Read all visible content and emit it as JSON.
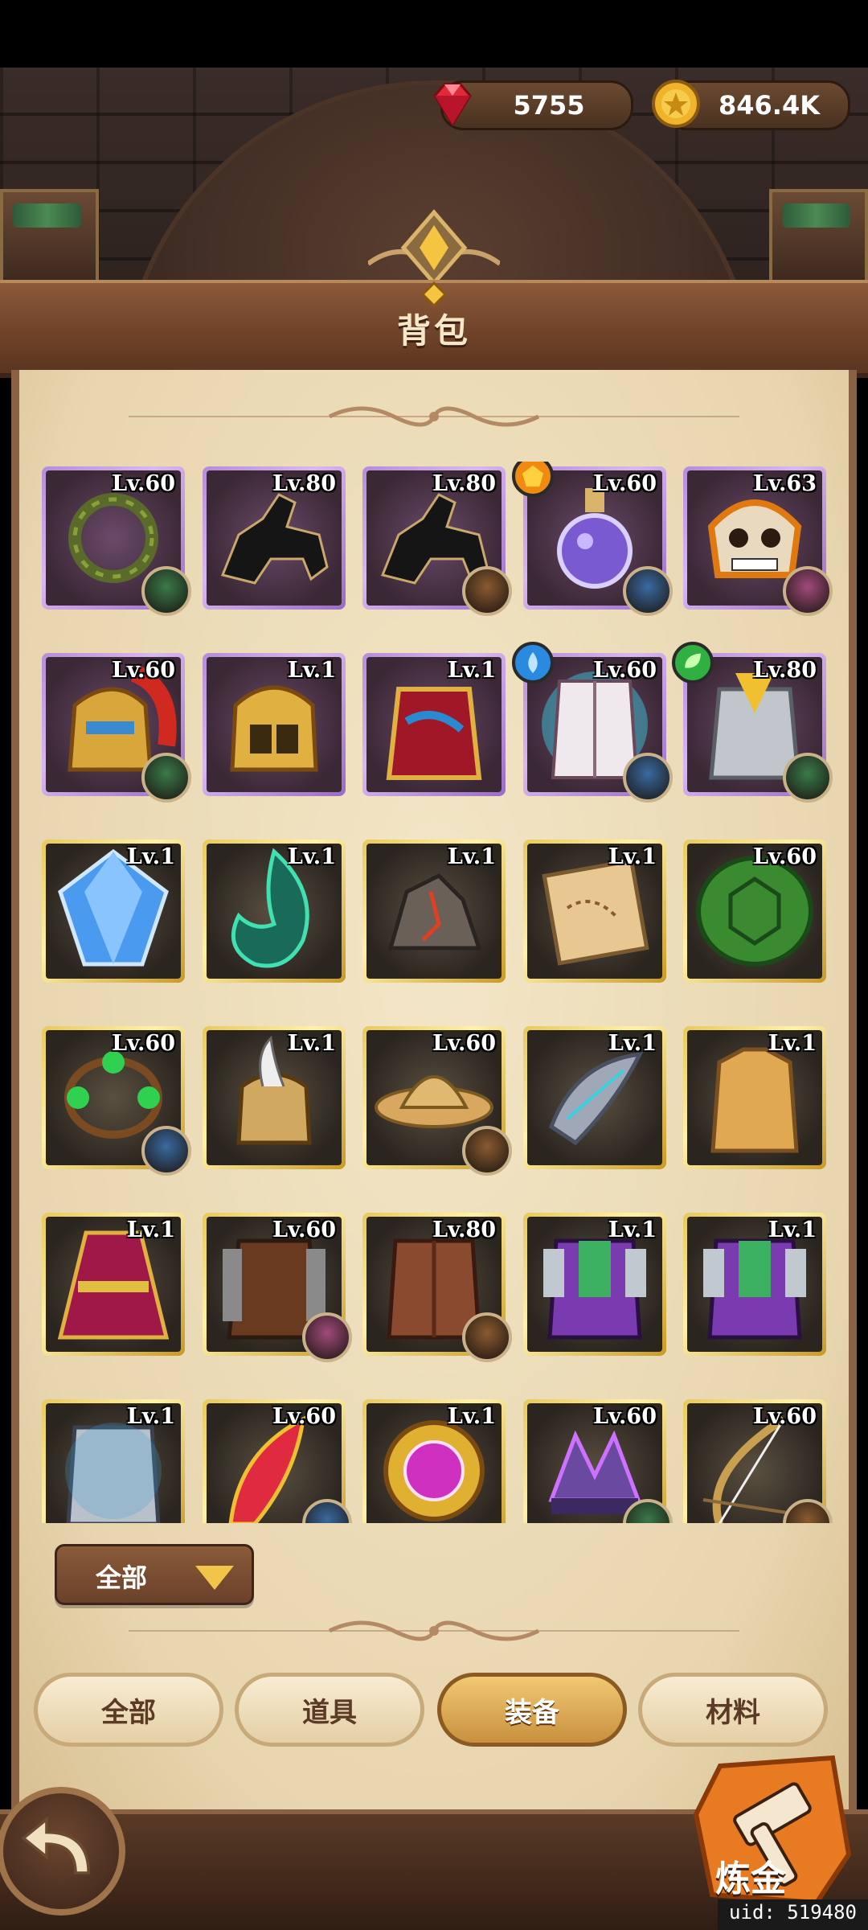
{
  "currency": {
    "gems": "5755",
    "gold": "846.4K",
    "gem_icon": "ruby-gem-icon",
    "gold_icon": "gold-coin-icon"
  },
  "title": "背包",
  "colors": {
    "purple_frame": "#b58cd9",
    "gold_frame": "#e8c85a",
    "selected_tab": "#d9a24f",
    "header_brown": "#6d4128"
  },
  "items": [
    {
      "level": "Lv.60",
      "rarity": "purple",
      "icon": "thorn-crown-icon",
      "owner": "goblin-hero-avatar"
    },
    {
      "level": "Lv.80",
      "rarity": "purple",
      "icon": "black-horse-icon"
    },
    {
      "level": "Lv.80",
      "rarity": "purple",
      "icon": "black-horse-icon",
      "owner": "warrior-hero-avatar"
    },
    {
      "level": "Lv.60",
      "rarity": "purple",
      "icon": "potion-flask-icon",
      "owner": "mage-hero-avatar",
      "badge": "orange-gem-badge"
    },
    {
      "level": "Lv.63",
      "rarity": "purple",
      "icon": "skull-mask-icon",
      "owner": "rogue-hero-avatar"
    },
    {
      "level": "Lv.60",
      "rarity": "purple",
      "icon": "red-plume-helmet-icon",
      "owner": "goblin-hero-avatar"
    },
    {
      "level": "Lv.1",
      "rarity": "purple",
      "icon": "golden-helmet-icon"
    },
    {
      "level": "Lv.1",
      "rarity": "purple",
      "icon": "crimson-armor-icon"
    },
    {
      "level": "Lv.60",
      "rarity": "purple",
      "icon": "white-vest-icon",
      "owner": "mage-hero-avatar",
      "badge": "blue-water-badge"
    },
    {
      "level": "Lv.80",
      "rarity": "purple",
      "icon": "silver-plate-armor-icon",
      "owner": "goblin-hero-avatar",
      "badge": "green-leaf-badge"
    },
    {
      "level": "Lv.1",
      "rarity": "gold",
      "icon": "blue-crystal-icon"
    },
    {
      "level": "Lv.1",
      "rarity": "gold",
      "icon": "green-flame-icon"
    },
    {
      "level": "Lv.1",
      "rarity": "gold",
      "icon": "ore-rocks-icon"
    },
    {
      "level": "Lv.1",
      "rarity": "gold",
      "icon": "treasure-map-icon"
    },
    {
      "level": "Lv.60",
      "rarity": "gold",
      "icon": "turtle-shell-icon"
    },
    {
      "level": "Lv.60",
      "rarity": "gold",
      "icon": "emerald-bracelet-icon",
      "owner": "mage-hero-avatar"
    },
    {
      "level": "Lv.1",
      "rarity": "gold",
      "icon": "horned-helmet-icon"
    },
    {
      "level": "Lv.60",
      "rarity": "gold",
      "icon": "straw-hat-icon",
      "owner": "warrior-hero-avatar"
    },
    {
      "level": "Lv.1",
      "rarity": "gold",
      "icon": "feather-gauntlet-icon"
    },
    {
      "level": "Lv.1",
      "rarity": "gold",
      "icon": "cloth-tunic-icon"
    },
    {
      "level": "Lv.1",
      "rarity": "gold",
      "icon": "crimson-cloak-icon"
    },
    {
      "level": "Lv.60",
      "rarity": "gold",
      "icon": "leather-chainmail-icon",
      "owner": "rogue-hero-avatar"
    },
    {
      "level": "Lv.80",
      "rarity": "gold",
      "icon": "leather-armor-icon",
      "owner": "warrior-hero-avatar"
    },
    {
      "level": "Lv.1",
      "rarity": "gold",
      "icon": "green-purple-armor-icon"
    },
    {
      "level": "Lv.1",
      "rarity": "gold",
      "icon": "green-purple-armor-icon"
    },
    {
      "level": "Lv.1",
      "rarity": "gold",
      "icon": "steel-armor-icon"
    },
    {
      "level": "Lv.60",
      "rarity": "gold",
      "icon": "phoenix-feather-icon",
      "owner": "mage-hero-avatar"
    },
    {
      "level": "Lv.1",
      "rarity": "gold",
      "icon": "magic-orb-icon"
    },
    {
      "level": "Lv.60",
      "rarity": "gold",
      "icon": "spider-crown-icon",
      "owner": "goblin-hero-avatar"
    },
    {
      "level": "Lv.60",
      "rarity": "gold",
      "icon": "golden-bow-icon",
      "owner": "warrior-hero-avatar"
    }
  ],
  "filter": {
    "label": "全部",
    "icon": "dropdown-triangle-icon"
  },
  "tabs": [
    {
      "label": "全部",
      "selected": false
    },
    {
      "label": "道具",
      "selected": false
    },
    {
      "label": "装备",
      "selected": true
    },
    {
      "label": "材料",
      "selected": false
    }
  ],
  "back_button": {
    "icon": "back-arrow-icon"
  },
  "alchemy_button": {
    "label": "炼金",
    "icon": "hammer-icon"
  },
  "uid": "uid: 519480"
}
